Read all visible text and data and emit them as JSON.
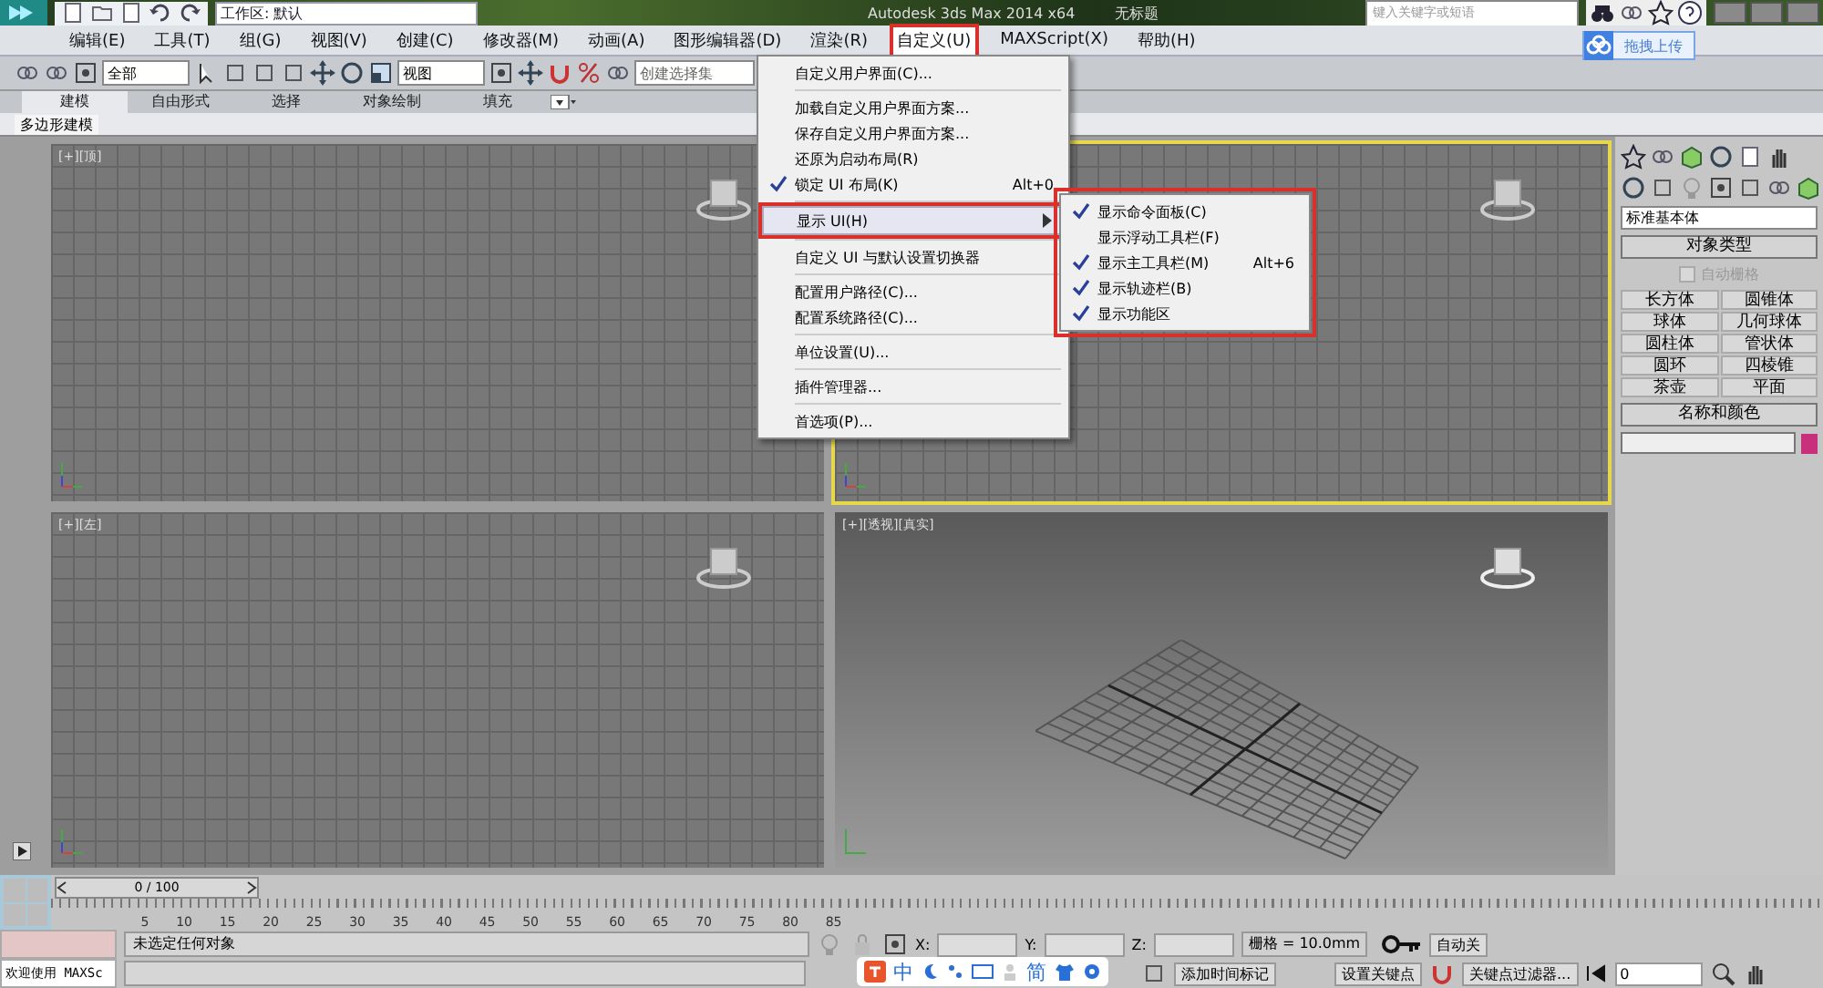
{
  "title_bar": {
    "workspace": "工作区: 默认",
    "title": "Autodesk 3ds Max  2014 x64",
    "document": "无标题",
    "search": {
      "placeholder": "键入关键字或短语"
    }
  },
  "upload_button": "拖拽上传",
  "menu_bar": [
    {
      "label": "编辑(E)",
      "selected": false,
      "annotated": false
    },
    {
      "label": "工具(T)",
      "selected": false,
      "annotated": false
    },
    {
      "label": "组(G)",
      "selected": false,
      "annotated": false
    },
    {
      "label": "视图(V)",
      "selected": false,
      "annotated": false
    },
    {
      "label": "创建(C)",
      "selected": false,
      "annotated": false
    },
    {
      "label": "修改器(M)",
      "selected": false,
      "annotated": false
    },
    {
      "label": "动画(A)",
      "selected": false,
      "annotated": false
    },
    {
      "label": "图形编辑器(D)",
      "selected": false,
      "annotated": false
    },
    {
      "label": "渲染(R)",
      "selected": false,
      "annotated": false
    },
    {
      "label": "自定义(U)",
      "selected": true,
      "annotated": true
    },
    {
      "label": "MAXScript(X)",
      "selected": false,
      "annotated": false
    },
    {
      "label": "帮助(H)",
      "selected": false,
      "annotated": false
    }
  ],
  "toolbar": {
    "selection_filter": "全部",
    "reference_coord": "视图",
    "named_selection": {
      "placeholder": "创建选择集"
    }
  },
  "ribbon": {
    "tabs": [
      {
        "label": "建模",
        "selected": true
      },
      {
        "label": "自由形式",
        "selected": false
      },
      {
        "label": "选择",
        "selected": false
      },
      {
        "label": "对象绘制",
        "selected": false
      },
      {
        "label": "填充",
        "selected": false
      }
    ],
    "panel": "多边形建模"
  },
  "viewports": [
    {
      "label": "[+][顶]",
      "kind": "ortho",
      "active": false
    },
    {
      "kind": "ortho",
      "active": true
    },
    {
      "label": "[+][左]",
      "kind": "ortho",
      "active": false
    },
    {
      "label": "[+][透视][真实]",
      "kind": "perspective",
      "active": false
    }
  ],
  "customize_menu": {
    "items": [
      {
        "kind": "item",
        "label": "自定义用户界面(C)...",
        "checked": false,
        "selected": false,
        "annotated": false
      },
      {
        "kind": "separator"
      },
      {
        "kind": "item",
        "label": "加载自定义用户界面方案...",
        "checked": false,
        "selected": false,
        "annotated": false
      },
      {
        "kind": "item",
        "label": "保存自定义用户界面方案...",
        "checked": false,
        "selected": false,
        "annotated": false
      },
      {
        "kind": "item",
        "label": "还原为启动布局(R)",
        "checked": false,
        "selected": false,
        "annotated": false
      },
      {
        "kind": "item",
        "label": "锁定 UI 布局(K)",
        "shortcut": "Alt+0",
        "checked": true,
        "selected": false,
        "annotated": false
      },
      {
        "kind": "separator"
      },
      {
        "kind": "submenu",
        "label": "显示 UI(H)",
        "checked": false,
        "selected": true,
        "annotated": true
      },
      {
        "kind": "separator"
      },
      {
        "kind": "item",
        "label": "自定义 UI 与默认设置切换器",
        "checked": false,
        "selected": false,
        "annotated": false
      },
      {
        "kind": "separator"
      },
      {
        "kind": "item",
        "label": "配置用户路径(C)...",
        "checked": false,
        "selected": false,
        "annotated": false
      },
      {
        "kind": "item",
        "label": "配置系统路径(C)...",
        "checked": false,
        "selected": false,
        "annotated": false
      },
      {
        "kind": "separator"
      },
      {
        "kind": "item",
        "label": "单位设置(U)...",
        "checked": false,
        "selected": false,
        "annotated": false
      },
      {
        "kind": "separator"
      },
      {
        "kind": "item",
        "label": "插件管理器...",
        "checked": false,
        "selected": false,
        "annotated": false
      },
      {
        "kind": "separator"
      },
      {
        "kind": "item",
        "label": "首选项(P)...",
        "checked": false,
        "selected": false,
        "annotated": false
      }
    ]
  },
  "show_ui_submenu": {
    "annotated": true,
    "items": [
      {
        "label": "显示命令面板(C)",
        "checked": true
      },
      {
        "label": "显示浮动工具栏(F)",
        "checked": false
      },
      {
        "label": "显示主工具栏(M)",
        "shortcut": "Alt+6",
        "checked": true
      },
      {
        "label": "显示轨迹栏(B)",
        "checked": true
      },
      {
        "label": "显示功能区",
        "checked": true
      }
    ]
  },
  "command_panel": {
    "category": "标准基本体",
    "object_type": {
      "title": "对象类型",
      "autogrid": {
        "label": "自动栅格",
        "checked": false,
        "disabled": true
      },
      "buttons": [
        "长方体",
        "圆锥体",
        "球体",
        "几何球体",
        "圆柱体",
        "管状体",
        "圆环",
        "四棱锥",
        "茶壶",
        "平面"
      ]
    },
    "name_and_color": {
      "title": "名称和颜色",
      "color": "#c8307c"
    }
  },
  "timeline": {
    "frame": "0 / 100",
    "level": 0,
    "ticks": [
      "5",
      "10",
      "15",
      "20",
      "25",
      "30",
      "35",
      "40",
      "45",
      "50",
      "55",
      "60",
      "65",
      "70",
      "75",
      "80",
      "85"
    ]
  },
  "status_bar": {
    "listener": "欢迎使用 MAXSc",
    "message": "未选定任何对象",
    "x_label": "X:",
    "y_label": "Y:",
    "z_label": "Z:",
    "grid": "栅格 = 10.0mm",
    "add_time_tag": "添加时间标记",
    "auto_key": "自动关",
    "set_key": "设置关键点",
    "key_filters": "关键点过滤器...",
    "frame_value": "0"
  },
  "ime_bar": {
    "items": [
      "中",
      "简"
    ]
  }
}
